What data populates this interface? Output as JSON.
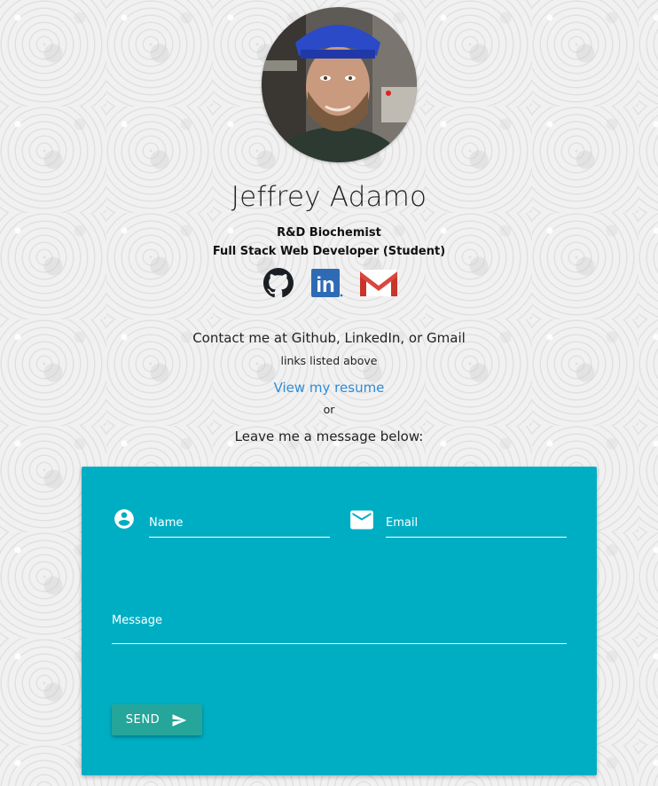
{
  "profile": {
    "name": "Jeffrey Adamo",
    "title_line1": "R&D Biochemist",
    "title_line2": "Full Stack Web Developer (Student)",
    "avatar_icon": "profile-photo"
  },
  "social": {
    "github_icon": "github-icon",
    "linkedin_icon": "linkedin-icon",
    "gmail_icon": "gmail-icon",
    "linkedin_text": "in"
  },
  "contact": {
    "line1": "Contact me at Github, LinkedIn, or Gmail",
    "line2": "links listed above",
    "resume_link": "View my resume",
    "or": "or",
    "leave_message": "Leave me a message below:"
  },
  "form": {
    "name_placeholder": "Name",
    "email_placeholder": "Email",
    "message_placeholder": "Message",
    "send_label": "SEND",
    "background_color": "#00aec4",
    "button_color": "#26a69a"
  }
}
